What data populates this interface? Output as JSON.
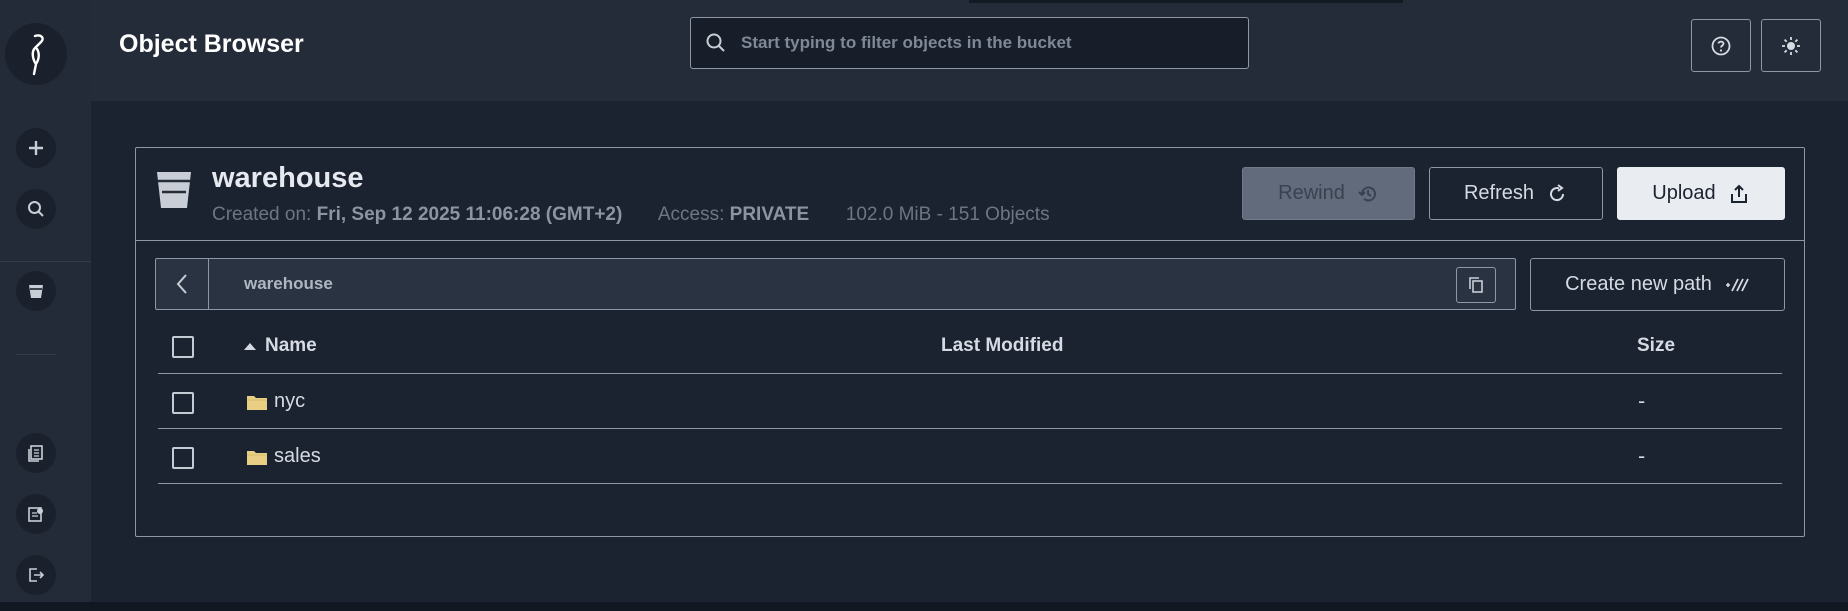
{
  "header": {
    "title": "Object Browser",
    "search_placeholder": "Start typing to filter objects in the bucket",
    "help_icon": "help-circle-icon",
    "theme_icon": "sun-icon"
  },
  "sidebar": {
    "icons": [
      "minio-logo",
      "plus-icon",
      "search-icon",
      "bucket-icon",
      "docs-icon",
      "license-icon",
      "logout-icon"
    ]
  },
  "bucket": {
    "name": "warehouse",
    "created_label": "Created on:",
    "created_value": "Fri, Sep 12 2025 11:06:28 (GMT+2)",
    "access_label": "Access:",
    "access_value": "PRIVATE",
    "usage": "102.0 MiB - 151 Objects"
  },
  "actions": {
    "rewind": "Rewind",
    "refresh": "Refresh",
    "upload": "Upload",
    "create_path": "Create new path"
  },
  "breadcrumb": {
    "path": "warehouse"
  },
  "table": {
    "columns": {
      "name": "Name",
      "modified": "Last Modified",
      "size": "Size"
    },
    "rows": [
      {
        "name": "nyc",
        "modified": "",
        "size": "-"
      },
      {
        "name": "sales",
        "modified": "",
        "size": "-"
      }
    ]
  },
  "colors": {
    "background": "#1b2230",
    "header": "#242c39",
    "sidebar": "#232b38",
    "folder": "#e8cf84",
    "upload_bg": "#e9edf1"
  }
}
